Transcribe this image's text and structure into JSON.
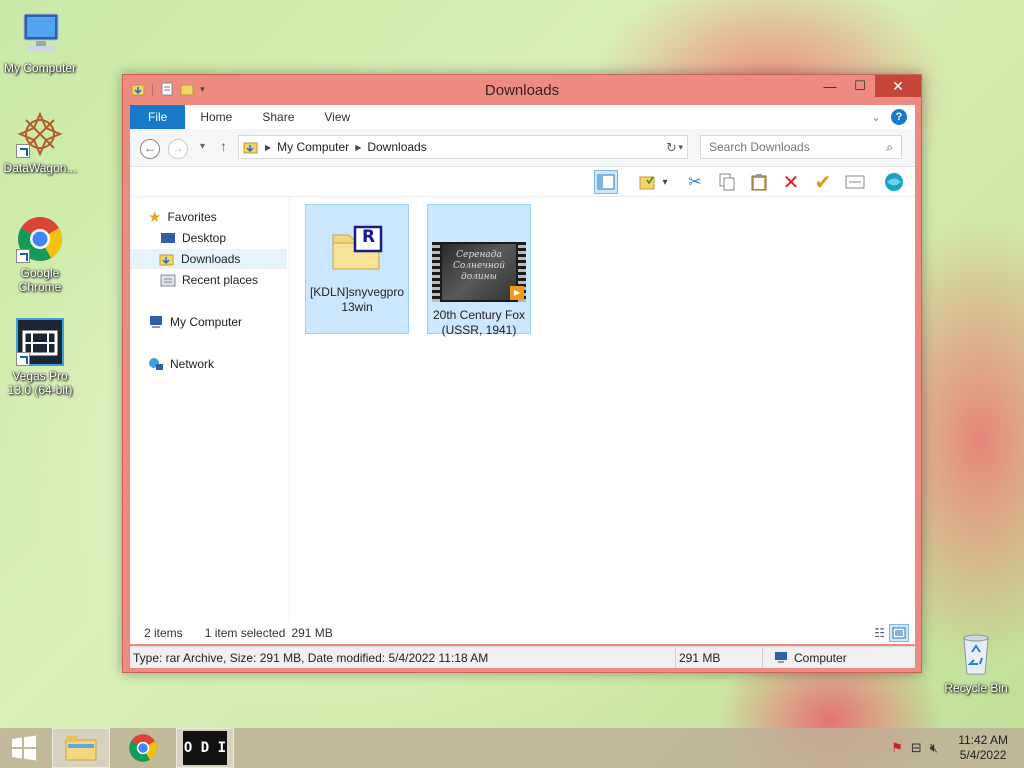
{
  "desktop": {
    "icons": [
      {
        "label": "My Computer"
      },
      {
        "label": "DataWagon..."
      },
      {
        "label": "Google Chrome"
      },
      {
        "label": "Vegas Pro 13.0 (64-bit)"
      },
      {
        "label": "Recycle Bin"
      }
    ]
  },
  "window": {
    "title": "Downloads",
    "controls": {
      "minimize": "—",
      "maximize": "☐",
      "close": "✕"
    },
    "ribbon_tabs": [
      "File",
      "Home",
      "Share",
      "View"
    ],
    "help": "?",
    "address": {
      "crumbs": [
        "My Computer",
        "Downloads"
      ]
    },
    "search": {
      "placeholder": "Search Downloads"
    },
    "nav": {
      "favorites": "Favorites",
      "items": [
        "Desktop",
        "Downloads",
        "Recent places"
      ],
      "computer": "My Computer",
      "network": "Network"
    },
    "files": [
      {
        "name": "[KDLN]snyvegpro 13win",
        "line1": "[KDLN]snyvegpro",
        "line2": "13win",
        "badge": "R"
      },
      {
        "name": "20th Century Fox (USSR, 1941)",
        "line1": "20th Century Fox",
        "line2": "(USSR, 1941)",
        "thumb_text_1": "Серенада",
        "thumb_text_2": "Солнечной",
        "thumb_text_3": "долины"
      }
    ],
    "status": {
      "count": "2 items",
      "selected": "1 item selected",
      "size": "291 MB"
    },
    "details": {
      "info": "Type: rar Archive, Size: 291 MB, Date modified: 5/4/2022 11:18 AM",
      "size": "291 MB",
      "location": "Computer"
    }
  },
  "taskbar": {
    "time": "11:42 AM",
    "date": "5/4/2022",
    "app_labels": {
      "odi": "O D I"
    }
  },
  "colors": {
    "frame": "#ee8b80",
    "close": "#c7463a",
    "accent": "#1979ca",
    "selection": "#cce8ff"
  }
}
